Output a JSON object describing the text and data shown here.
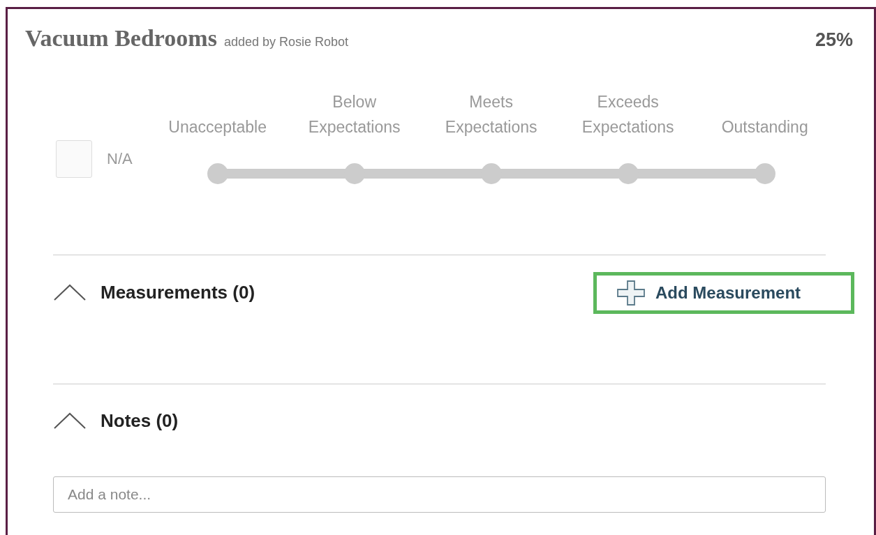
{
  "card": {
    "title": "Vacuum Bedrooms",
    "byline": "added by Rosie Robot",
    "percent": "25%"
  },
  "na": {
    "label": "N/A",
    "checked": false
  },
  "scale": [
    {
      "label": "Unacceptable",
      "selected": false
    },
    {
      "label": "Below Expectations",
      "selected": false
    },
    {
      "label": "Meets Expectations",
      "selected": false
    },
    {
      "label": "Exceeds Expectations",
      "selected": false
    },
    {
      "label": "Outstanding",
      "selected": false
    }
  ],
  "sections": [
    {
      "title": "Measurements (0)",
      "expanded": true,
      "action": "Add Measurement"
    },
    {
      "title": "Notes (0)",
      "expanded": true
    }
  ],
  "note_field": {
    "placeholder": "Add a note..."
  }
}
